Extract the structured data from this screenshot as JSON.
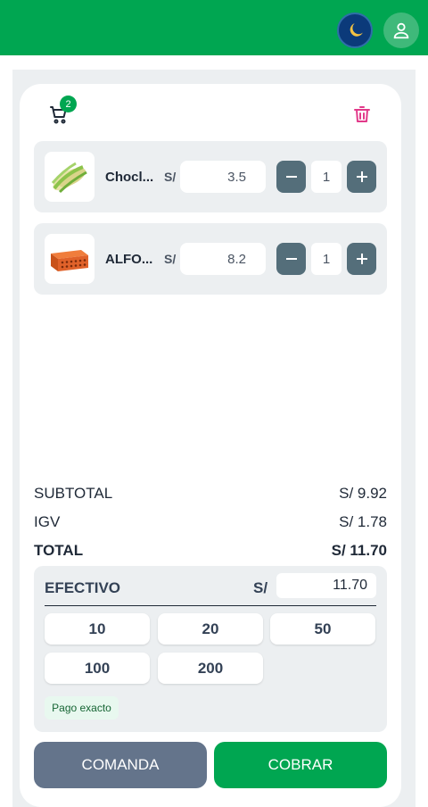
{
  "header": {
    "theme_icon": "moon-icon",
    "user_icon": "user-icon",
    "brand_color": "#00a651"
  },
  "cart": {
    "icon": "cart-icon",
    "count": "2",
    "clear_icon": "trash-icon",
    "items": [
      {
        "name": "Chocl...",
        "currency": "S/",
        "price": "3.5",
        "quantity": "1",
        "image": "corn-image"
      },
      {
        "name": "ALFO...",
        "currency": "S/",
        "price": "8.2",
        "quantity": "1",
        "image": "brick-image"
      }
    ]
  },
  "summary": {
    "subtotal_label": "SUBTOTAL",
    "subtotal_value": "S/ 9.92",
    "igv_label": "IGV",
    "igv_value": "S/ 1.78",
    "total_label": "TOTAL",
    "total_value": "S/ 11.70"
  },
  "payment": {
    "method": "EFECTIVO",
    "currency": "S/",
    "amount": "11.70",
    "quick_amounts": [
      "10",
      "20",
      "50",
      "100",
      "200"
    ],
    "exact_label": "Pago exacto"
  },
  "actions": {
    "comanda": "COMANDA",
    "cobrar": "COBRAR"
  }
}
